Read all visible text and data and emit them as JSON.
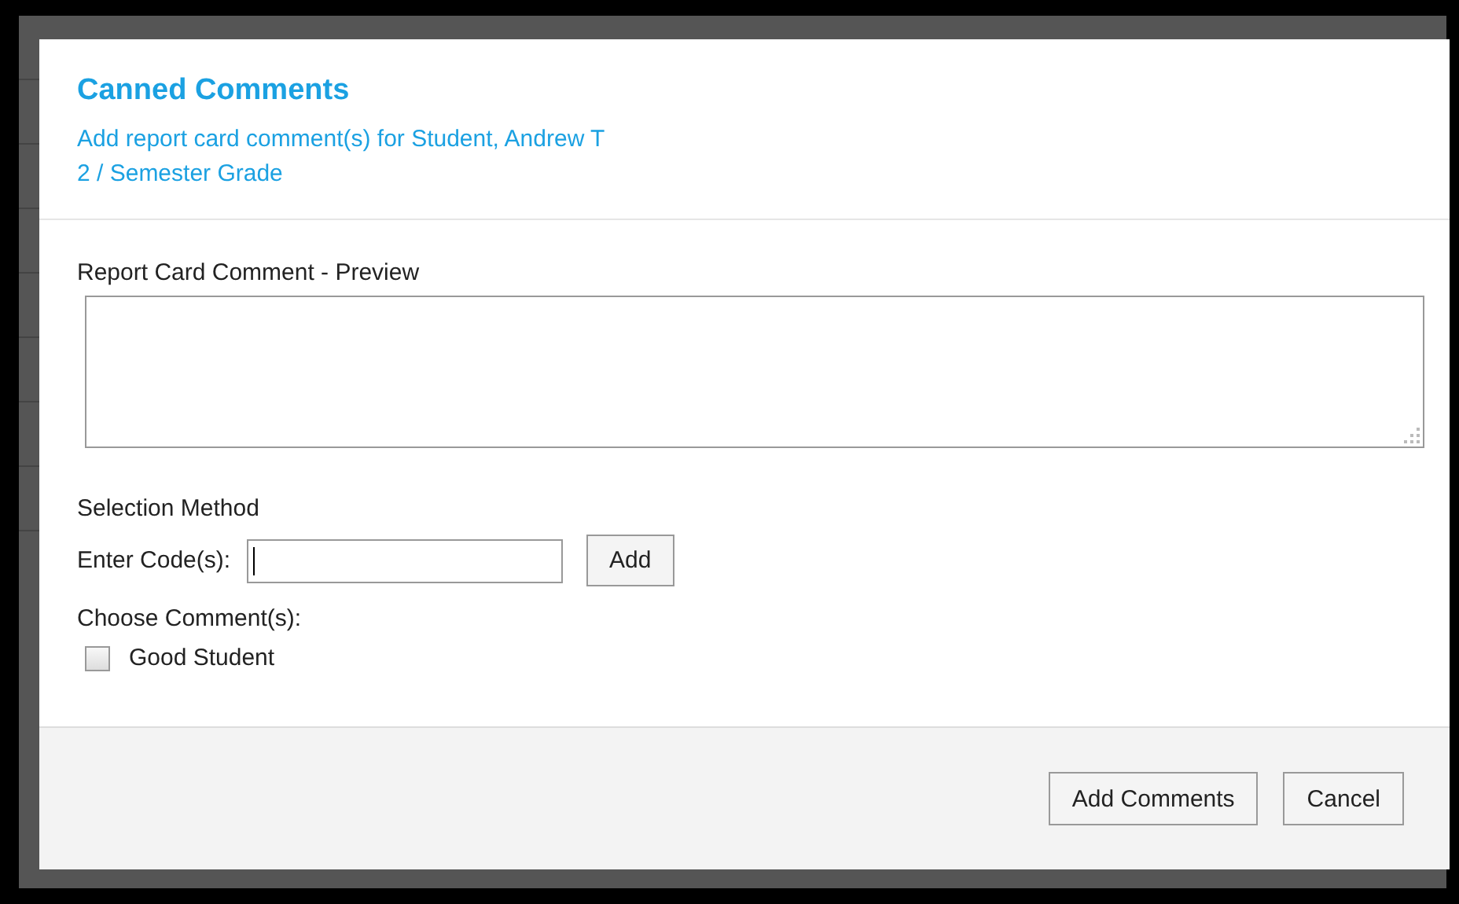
{
  "dialog": {
    "title": "Canned Comments",
    "subtitle": "Add report card comment(s) for Student, Andrew T",
    "grade": "2 / Semester Grade",
    "preview": {
      "label": "Report Card Comment - Preview"
    },
    "selection_method": {
      "label": "Selection Method",
      "code_label": "Enter Code(s):",
      "add_button": "Add"
    },
    "choose": {
      "label": "Choose Comment(s):",
      "comments": [
        {
          "label": "Good Student",
          "checked": false
        }
      ]
    },
    "add_comments_button": "Add Comments",
    "cancel_button": "Cancel"
  }
}
